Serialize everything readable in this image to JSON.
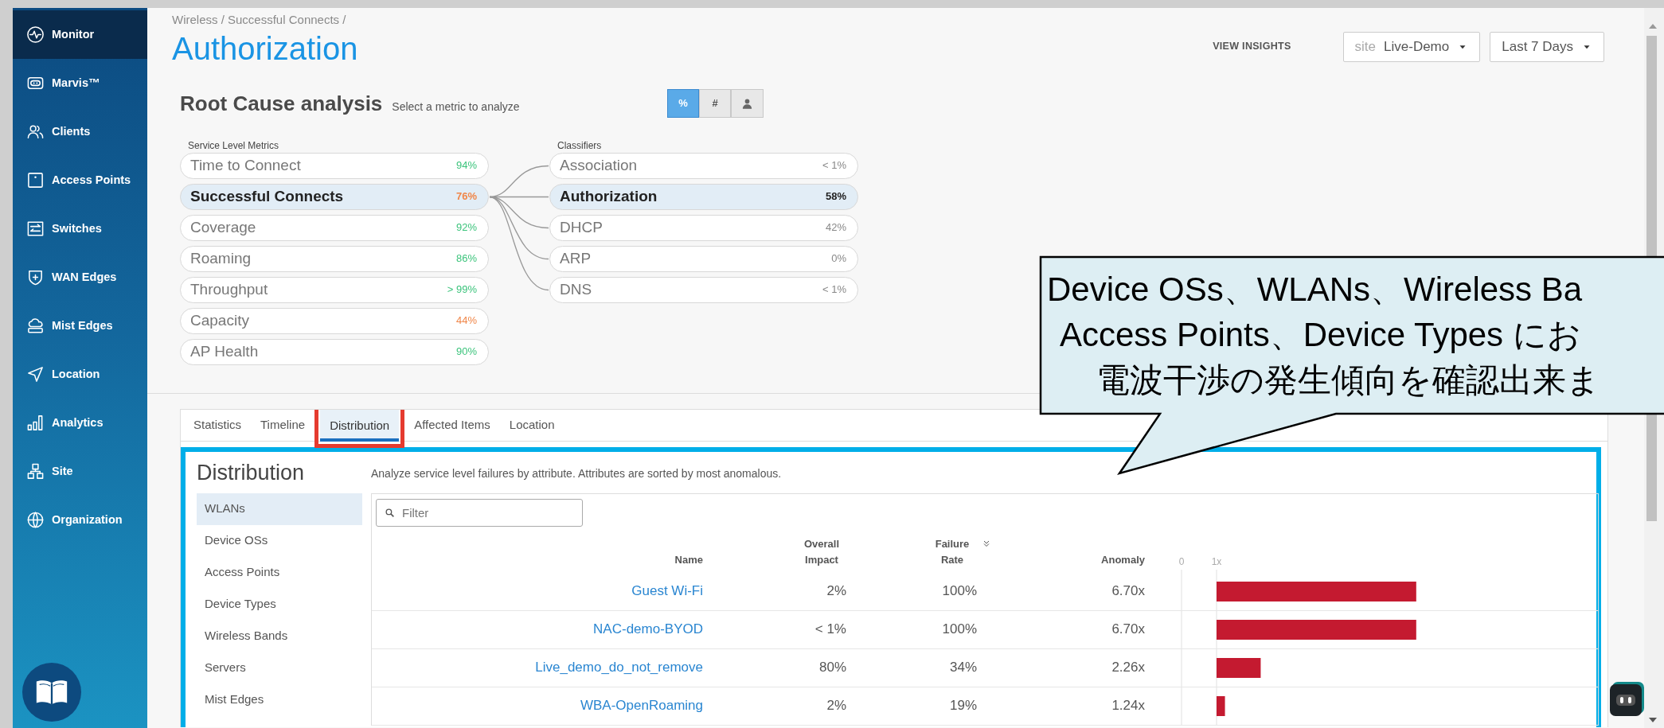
{
  "sidebar": {
    "items": [
      {
        "label": "Monitor",
        "selected": true
      },
      {
        "label": "Marvis™",
        "selected": false
      },
      {
        "label": "Clients",
        "selected": false
      },
      {
        "label": "Access Points",
        "selected": false
      },
      {
        "label": "Switches",
        "selected": false
      },
      {
        "label": "WAN Edges",
        "selected": false
      },
      {
        "label": "Mist Edges",
        "selected": false
      },
      {
        "label": "Location",
        "selected": false
      },
      {
        "label": "Analytics",
        "selected": false
      },
      {
        "label": "Site",
        "selected": false
      },
      {
        "label": "Organization",
        "selected": false
      }
    ]
  },
  "breadcrumb": "Wireless / Successful Connects /",
  "page_title": "Authorization",
  "header_actions": {
    "view_insights": "VIEW INSIGHTS",
    "site_selector": {
      "label": "site",
      "value": "Live-Demo"
    },
    "date_range": {
      "value": "Last 7 Days"
    }
  },
  "root_cause": {
    "title": "Root Cause analysis",
    "subtitle": "Select a metric to analyze",
    "toggles": [
      {
        "kind": "text",
        "label": "%",
        "selected": true
      },
      {
        "kind": "text",
        "label": "#",
        "selected": false
      },
      {
        "kind": "icon",
        "selected": false
      }
    ],
    "metrics_label": "Service Level Metrics",
    "metrics": [
      {
        "label": "Time to Connect",
        "value": "94%",
        "color": "#3cc47c",
        "selected": false
      },
      {
        "label": "Successful Connects",
        "value": "76%",
        "color": "#f0874a",
        "selected": true
      },
      {
        "label": "Coverage",
        "value": "92%",
        "color": "#3cc47c",
        "selected": false
      },
      {
        "label": "Roaming",
        "value": "86%",
        "color": "#3cc47c",
        "selected": false
      },
      {
        "label": "Throughput",
        "value": "> 99%",
        "color": "#3cc47c",
        "selected": false
      },
      {
        "label": "Capacity",
        "value": "44%",
        "color": "#f0874a",
        "selected": false
      },
      {
        "label": "AP Health",
        "value": "90%",
        "color": "#3cc47c",
        "selected": false
      }
    ],
    "classifiers_label": "Classifiers",
    "classifiers": [
      {
        "label": "Association",
        "value": "< 1%",
        "selected": false
      },
      {
        "label": "Authorization",
        "value": "58%",
        "selected": true
      },
      {
        "label": "DHCP",
        "value": "42%",
        "selected": false
      },
      {
        "label": "ARP",
        "value": "0%",
        "selected": false
      },
      {
        "label": "DNS",
        "value": "< 1%",
        "selected": false
      }
    ]
  },
  "tabs": [
    {
      "label": "Statistics",
      "selected": false,
      "highlighted": false
    },
    {
      "label": "Timeline",
      "selected": false,
      "highlighted": false
    },
    {
      "label": "Distribution",
      "selected": true,
      "highlighted": true
    },
    {
      "label": "Affected Items",
      "selected": false,
      "highlighted": false
    },
    {
      "label": "Location",
      "selected": false,
      "highlighted": false
    }
  ],
  "distribution": {
    "title": "Distribution",
    "description": "Analyze service level failures by attribute. Attributes are sorted by most anomalous.",
    "attributes": [
      {
        "label": "WLANs",
        "selected": true
      },
      {
        "label": "Device OSs",
        "selected": false
      },
      {
        "label": "Access Points",
        "selected": false
      },
      {
        "label": "Device Types",
        "selected": false
      },
      {
        "label": "Wireless Bands",
        "selected": false
      },
      {
        "label": "Servers",
        "selected": false
      },
      {
        "label": "Mist Edges",
        "selected": false
      }
    ],
    "filter": {
      "placeholder": "Filter"
    },
    "columns": [
      "Name",
      "Overall Impact",
      "Failure Rate",
      "Anomaly"
    ],
    "rows": [
      {
        "name": "Guest Wi-Fi",
        "overall_impact": "2%",
        "failure_rate": "100%",
        "anomaly": "6.70x"
      },
      {
        "name": "NAC-demo-BYOD",
        "overall_impact": "< 1%",
        "failure_rate": "100%",
        "anomaly": "6.70x"
      },
      {
        "name": "Live_demo_do_not_remove",
        "overall_impact": "80%",
        "failure_rate": "34%",
        "anomaly": "2.26x"
      },
      {
        "name": "WBA-OpenRoaming",
        "overall_impact": "2%",
        "failure_rate": "19%",
        "anomaly": "1.24x"
      }
    ],
    "scale_labels": [
      "0",
      "1x"
    ]
  },
  "callout": {
    "lines": [
      "Device OSs、WLANs、Wireless Ba",
      "Access Points、Device Types にお",
      "電波干渉の発生傾向を確認出来ま"
    ]
  }
}
